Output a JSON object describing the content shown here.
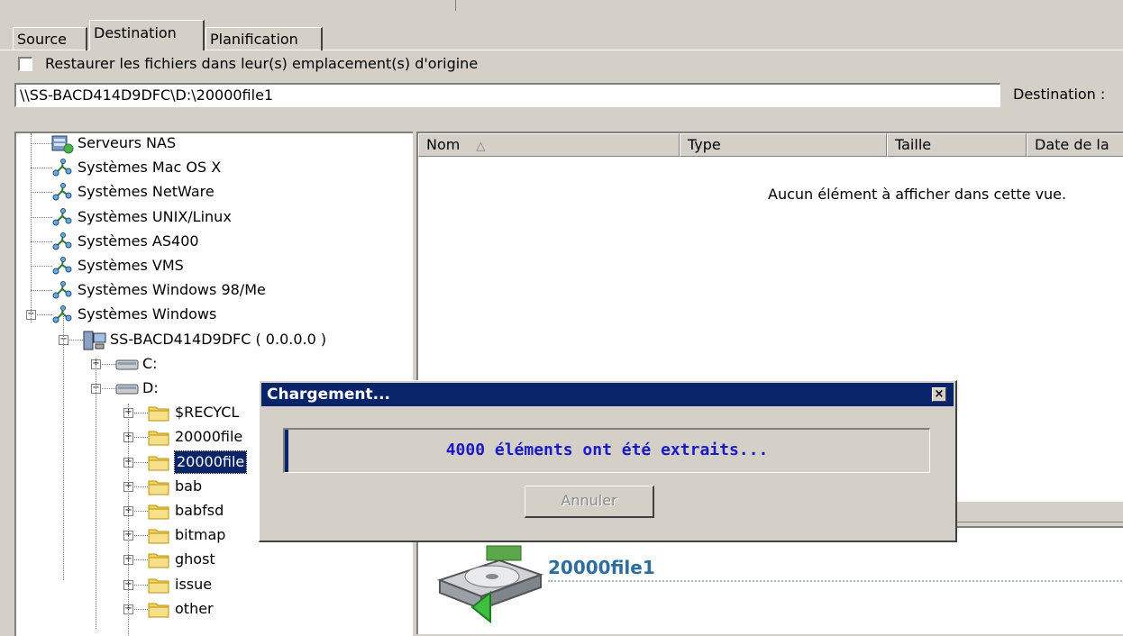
{
  "tabs": [
    {
      "label": "Source"
    },
    {
      "label": "Destination"
    },
    {
      "label": "Planification"
    }
  ],
  "restore_option": {
    "label": "Restaurer les fichiers dans leur(s) emplacement(s) d'origine",
    "checked": false
  },
  "destination": {
    "path": "\\\\SS-BACD414D9DFC\\D:\\20000file1",
    "label": "Destination :"
  },
  "tree": {
    "items": [
      {
        "label": "Serveurs NAS",
        "icon": "nas-server-icon"
      },
      {
        "label": "Systèmes Mac OS X",
        "icon": "network-icon"
      },
      {
        "label": "Systèmes NetWare",
        "icon": "network-icon"
      },
      {
        "label": "Systèmes UNIX/Linux",
        "icon": "network-icon"
      },
      {
        "label": "Systèmes AS400",
        "icon": "network-icon"
      },
      {
        "label": "Systèmes VMS",
        "icon": "network-icon"
      },
      {
        "label": "Systèmes Windows 98/Me",
        "icon": "network-icon"
      },
      {
        "label": "Systèmes Windows",
        "icon": "network-icon",
        "expanded": true
      },
      {
        "label": "SS-BACD414D9DFC ( 0.0.0.0 )",
        "icon": "computer-icon",
        "expanded": true
      },
      {
        "label": "C:",
        "icon": "drive-icon"
      },
      {
        "label": "D:",
        "icon": "drive-icon",
        "expanded": true
      },
      {
        "label": "$RECYCL",
        "icon": "folder-icon"
      },
      {
        "label": "20000file",
        "icon": "folder-icon"
      },
      {
        "label": "20000file",
        "icon": "folder-icon",
        "selected": true
      },
      {
        "label": "bab",
        "icon": "folder-icon"
      },
      {
        "label": "babfsd",
        "icon": "folder-icon"
      },
      {
        "label": "bitmap",
        "icon": "folder-icon"
      },
      {
        "label": "ghost",
        "icon": "folder-icon"
      },
      {
        "label": "issue",
        "icon": "folder-icon"
      },
      {
        "label": "other",
        "icon": "folder-icon"
      }
    ]
  },
  "list": {
    "columns": [
      {
        "label": "Nom"
      },
      {
        "label": "Type"
      },
      {
        "label": "Taille"
      },
      {
        "label": "Date de la"
      }
    ],
    "empty_message": "Aucun élément à afficher dans cette vue."
  },
  "drive_panel": {
    "label": "20000file1",
    "icon": "hard-drive-icon"
  },
  "dialog": {
    "title": "Chargement...",
    "progress_text": "4000 éléments ont été extraits...",
    "progress_fraction": 0.005,
    "cancel_label": "Annuler"
  },
  "colors": {
    "window_bg": "#d4d0c8",
    "title_bar": "#0a246a",
    "progress_text": "#1a1ac8",
    "drive_label": "#2c6e9e",
    "selection": "#0a246a"
  }
}
